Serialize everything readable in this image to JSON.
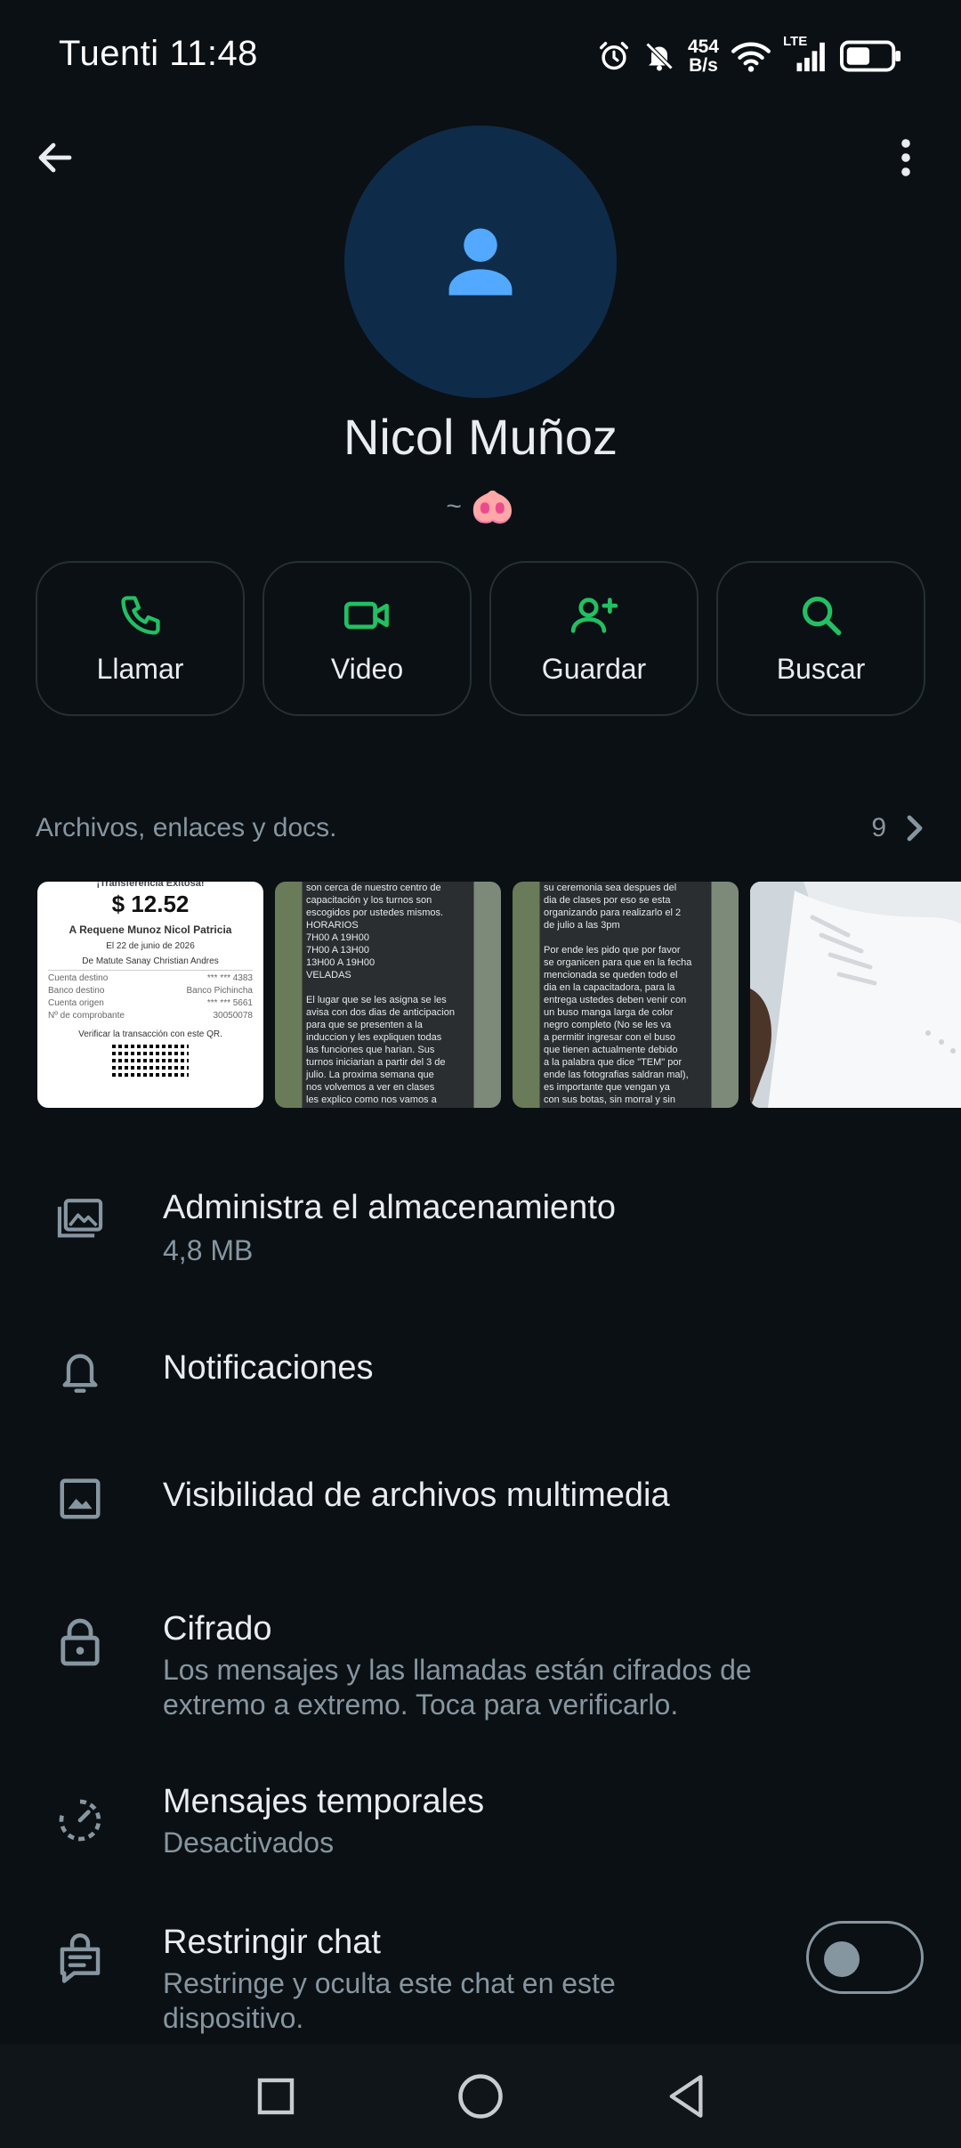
{
  "status_bar": {
    "time": "Tuenti 11:48",
    "net_speed_value": "454",
    "net_speed_unit": "B/s",
    "network_type": "LTE",
    "icons": [
      "alarm-icon",
      "bell-off-icon",
      "wifi-icon",
      "cell-signal-icon",
      "battery-icon"
    ]
  },
  "contact": {
    "name": "Nicol Muñoz",
    "about": "~",
    "about_emoji": "🐽"
  },
  "actions": [
    {
      "label": "Llamar",
      "icon": "phone-icon"
    },
    {
      "label": "Video",
      "icon": "video-icon"
    },
    {
      "label": "Guardar",
      "icon": "add-person-icon"
    },
    {
      "label": "Buscar",
      "icon": "search-icon"
    }
  ],
  "media": {
    "title": "Archivos, enlaces y docs.",
    "count": "9",
    "receipt": {
      "heading": "¡Transferencia Exitosa!",
      "amount": "$ 12.52",
      "to": "A Requene Munoz Nicol Patricia",
      "date": "El 22 de junio de 2026",
      "from": "De Matute Sanay Christian Andres",
      "rows": [
        {
          "k": "Cuenta destino",
          "v": "*** *** 4383"
        },
        {
          "k": "Banco destino",
          "v": "Banco Pichincha"
        },
        {
          "k": "Cuenta origen",
          "v": "*** *** 5661"
        },
        {
          "k": "Nº de comprobante",
          "v": "30050078"
        }
      ],
      "verify": "Verificar la transacción con este QR."
    },
    "msg2": "son cerca de nuestro centro de\ncapacitación y los turnos son\nescogidos por ustedes mismos.\nHORARIOS\n7H00 A 19H00\n7H00 A 13H00\n13H00 A 19H00\nVELADAS\n\nEl lugar que se les asigna se les\navisa con dos dias de anticipacion\npara que se presenten a la\ninduccion y les expliquen todas\nlas funciones que harian. Sus\nturnos iniciarian a partir del 3 de\njulio. La proxima semana que\nnos volvemos a ver en clases\nles explico como nos vamos a\nmanejar con el registro de sus",
    "msg3": "su ceremonia sea despues del\ndia de clases por eso se esta\norganizando para realizarlo el 2\nde julio a las 3pm\n\nPor ende les pido que por favor\nse organicen para que en la fecha\nmencionada se queden todo el\ndia en la capacitadora, para la\nentrega ustedes deben venir con\nun buso manga larga de color\nnegro completo (No se les va\na permitir ingresar con el buso\nque tienen actualmente debido\na la palabra que dice \"TEM\" por\nende las fotografias saldran mal),\nes importante que vengan ya\ncon sus botas, sin morral y sin\ncasco. Como son el unico grupo"
  },
  "settings": [
    {
      "title": "Administra el almacenamiento",
      "subtitle": "4,8 MB",
      "icon": "storage-icon"
    },
    {
      "title": "Notificaciones",
      "subtitle": "",
      "icon": "bell-icon"
    },
    {
      "title": "Visibilidad de archivos multimedia",
      "subtitle": "",
      "icon": "image-icon"
    },
    {
      "title": "Cifrado",
      "subtitle": "Los mensajes y las llamadas están cifrados de extremo a extremo. Toca para verificarlo.",
      "icon": "lock-icon"
    },
    {
      "title": "Mensajes temporales",
      "subtitle": "Desactivados",
      "icon": "timer-icon"
    },
    {
      "title": "Restringir chat",
      "subtitle": "Restringe y oculta este chat en este dispositivo.",
      "icon": "chat-lock-icon",
      "toggle": false
    }
  ],
  "colors": {
    "background": "#0b1014",
    "accent_green": "#21c063",
    "avatar_bg": "#0e2c4a",
    "avatar_fg": "#53a9ff",
    "secondary_text": "#8696a0"
  }
}
